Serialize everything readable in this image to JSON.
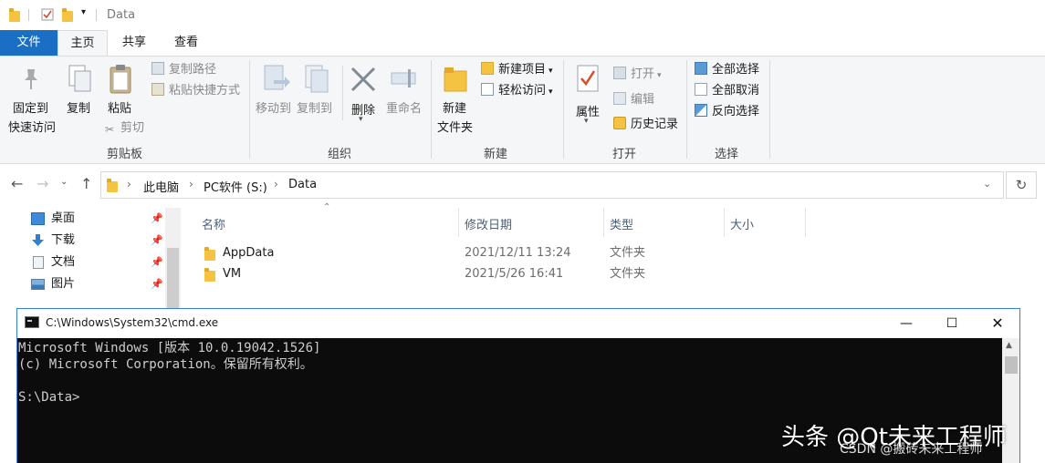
{
  "titlebar": {
    "title": "Data"
  },
  "tabs": {
    "file": "文件",
    "home": "主页",
    "share": "共享",
    "view": "查看"
  },
  "ribbon": {
    "clipboard": {
      "label": "剪贴板",
      "pin_quick_access": [
        "固定到",
        "快速访问"
      ],
      "copy": "复制",
      "paste": "粘贴",
      "copy_path": "复制路径",
      "paste_shortcut": "粘贴快捷方式",
      "cut": "剪切"
    },
    "organize": {
      "label": "组织",
      "move_to": "移动到",
      "copy_to": "复制到",
      "delete": "删除",
      "rename": "重命名"
    },
    "new": {
      "label": "新建",
      "new_folder": [
        "新建",
        "文件夹"
      ],
      "new_item": "新建项目",
      "easy_access": "轻松访问"
    },
    "open": {
      "label": "打开",
      "properties": "属性",
      "open": "打开",
      "edit": "编辑",
      "history": "历史记录"
    },
    "select": {
      "label": "选择",
      "select_all": "全部选择",
      "select_none": "全部取消",
      "invert": "反向选择"
    }
  },
  "address": {
    "crumbs": [
      "此电脑",
      "PC软件 (S:)",
      "Data"
    ]
  },
  "nav_pane": {
    "items": [
      {
        "label": "桌面",
        "icon": "desktop-icon"
      },
      {
        "label": "下载",
        "icon": "download-icon"
      },
      {
        "label": "文档",
        "icon": "document-icon"
      },
      {
        "label": "图片",
        "icon": "pictures-icon"
      }
    ]
  },
  "file_list": {
    "columns": {
      "name": "名称",
      "date": "修改日期",
      "type": "类型",
      "size": "大小"
    },
    "rows": [
      {
        "name": "AppData",
        "date": "2021/12/11 13:24",
        "type": "文件夹"
      },
      {
        "name": "VM",
        "date": "2021/5/26 16:41",
        "type": "文件夹"
      }
    ]
  },
  "cmd": {
    "title": "C:\\Windows\\System32\\cmd.exe",
    "lines": [
      "Microsoft Windows [版本 10.0.19042.1526]",
      "(c) Microsoft Corporation。保留所有权利。",
      "",
      "S:\\Data>"
    ]
  },
  "watermark": {
    "main": "头条 @Qt未来工程师",
    "sub": "CSDN @搬砖未来工程师"
  },
  "colors": {
    "accent": "#1a6fc4",
    "folder": "#f4c342",
    "console_bg": "#0c0c0c",
    "console_fg": "#cccccc"
  }
}
